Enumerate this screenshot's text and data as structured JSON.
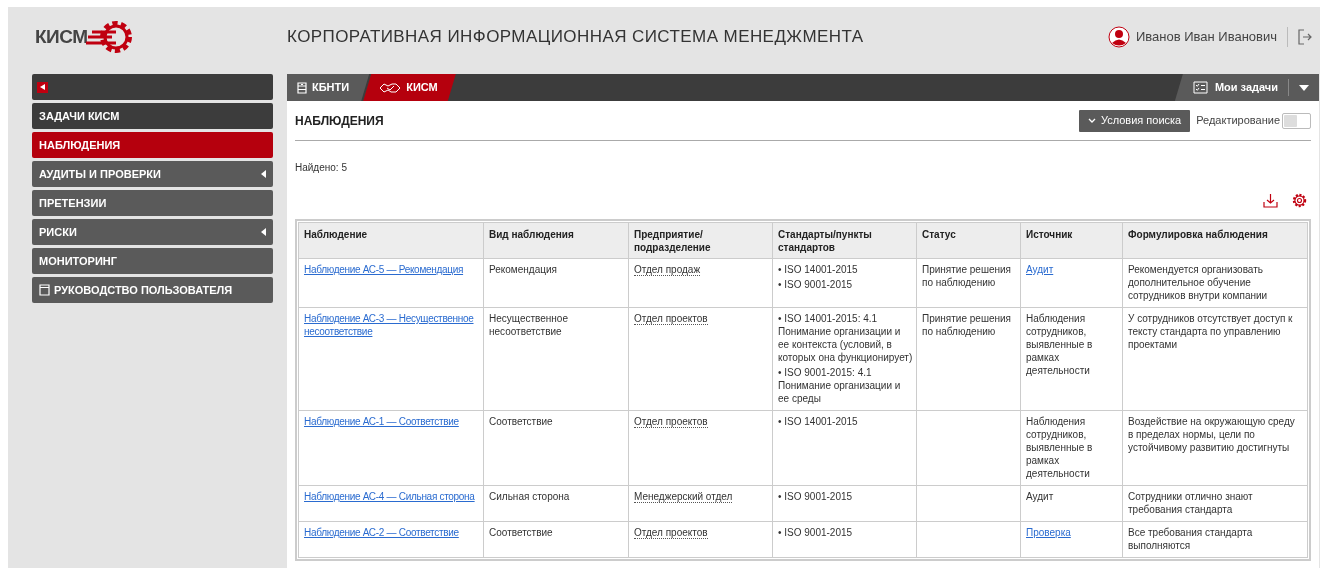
{
  "header": {
    "logo_text": "КИСМ",
    "title": "КОРПОРАТИВНАЯ ИНФОРМАЦИОННАЯ СИСТЕМА МЕНЕДЖМЕНТА",
    "user_name": "Иванов Иван Иванович"
  },
  "sidebar": {
    "items": [
      {
        "label": "ЗАДАЧИ КИСМ",
        "kind": "header",
        "selected": false,
        "submenu": false
      },
      {
        "label": "НАБЛЮДЕНИЯ",
        "kind": "item",
        "selected": true,
        "submenu": false
      },
      {
        "label": "АУДИТЫ И ПРОВЕРКИ",
        "kind": "item",
        "selected": false,
        "submenu": true
      },
      {
        "label": "ПРЕТЕНЗИИ",
        "kind": "item",
        "selected": false,
        "submenu": false
      },
      {
        "label": "РИСКИ",
        "kind": "item",
        "selected": false,
        "submenu": true
      },
      {
        "label": "МОНИТОРИНГ",
        "kind": "item",
        "selected": false,
        "submenu": false
      },
      {
        "label": "РУКОВОДСТВО ПОЛЬЗОВАТЕЛЯ",
        "kind": "guide",
        "selected": false,
        "submenu": false
      }
    ]
  },
  "tabs": [
    {
      "label": "КБНТИ",
      "kind": "box",
      "selected": false
    },
    {
      "label": "КИСМ",
      "kind": "gear",
      "selected": true
    }
  ],
  "my_tasks": {
    "label": "Мои задачи"
  },
  "page": {
    "title": "НАБЛЮДЕНИЯ",
    "search_button": "Условия поиска",
    "edit_toggle": {
      "label": "Редактирование",
      "on": false
    },
    "found": "Найдено: 5"
  },
  "table": {
    "columns": [
      "Наблюдение",
      "Вид наблюдения",
      "Предприятие/ подразделение",
      "Стандарты/пункты стандартов",
      "Статус",
      "Источник",
      "Формулировка наблюдения"
    ],
    "rows": [
      {
        "observation": "Наблюдение АС-5 — Рекомендация",
        "type": "Рекомендация",
        "department": "Отдел продаж",
        "standards": [
          "• ISO 14001-2015",
          "• ISO 9001-2015"
        ],
        "status": "Принятие решения по наблюдению",
        "source": {
          "text": "Аудит",
          "link": true
        },
        "wording": "Рекомендуется организовать дополнительное обучение сотрудников внутри компании"
      },
      {
        "observation": "Наблюдение АС-3 — Несущественное несоответствие",
        "type": "Несущественное несоответствие",
        "department": "Отдел проектов",
        "standards": [
          "• ISO 14001-2015: 4.1 Понимание организации и ее контекста (условий, в которых она функционирует)",
          "• ISO 9001-2015: 4.1 Понимание организации и ее среды"
        ],
        "status": "Принятие решения по наблюдению",
        "source": {
          "text": "Наблюдения сотрудников, выявленные в рамках деятельности",
          "link": false
        },
        "wording": "У сотрудников отсутствует доступ к тексту стандарта по управлению проектами"
      },
      {
        "observation": "Наблюдение АС-1 — Соответствие",
        "type": "Соответствие",
        "department": "Отдел проектов",
        "standards": [
          "• ISO 14001-2015"
        ],
        "source": {
          "text": "Наблюдения сотрудников, выявленные в рамках деятельности",
          "link": false
        },
        "wording": "Воздействие на окружающую среду в пределах нормы, цели по устойчивому развитию достигнуты"
      },
      {
        "observation": "Наблюдение АС-4 — Сильная сторона",
        "type": "Сильная сторона",
        "department": "Менеджерский отдел",
        "standards": [
          "• ISO 9001-2015"
        ],
        "source": {
          "text": "Аудит",
          "link": false
        },
        "wording": "Сотрудники отлично знают требования стандарта"
      },
      {
        "observation": "Наблюдение АС-2 — Соответствие",
        "type": "Соответствие",
        "department": "Отдел проектов",
        "standards": [
          "• ISO 9001-2015"
        ],
        "source": {
          "text": "Проверка",
          "link": true
        },
        "wording": "Все требования стандарта выполняются"
      }
    ]
  }
}
